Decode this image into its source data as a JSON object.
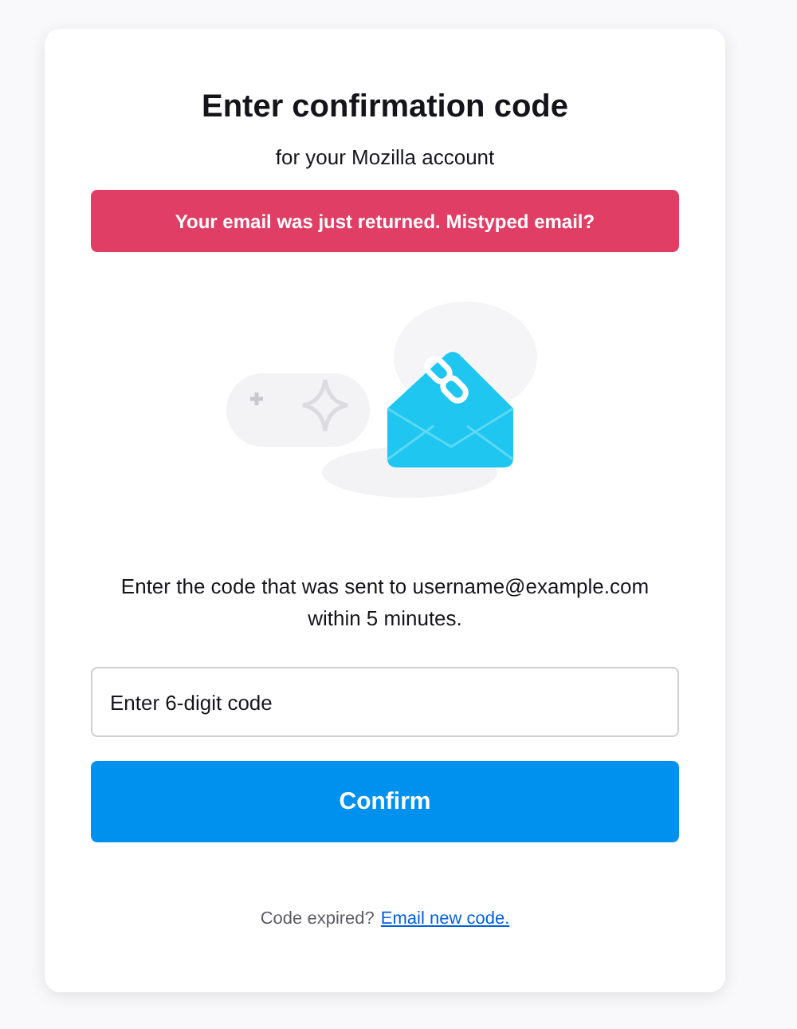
{
  "title": "Enter confirmation code",
  "subtitle": "for your Mozilla account",
  "banner": {
    "kind": "error",
    "text": "Your email was just returned. Mistyped email?"
  },
  "instructions": "Enter the code that was sent to username@example.com within 5 minutes.",
  "code_field": {
    "placeholder": "Enter 6-digit code"
  },
  "confirm_button": "Confirm",
  "footer": {
    "text": "Code expired?",
    "link": "Email new code."
  }
}
